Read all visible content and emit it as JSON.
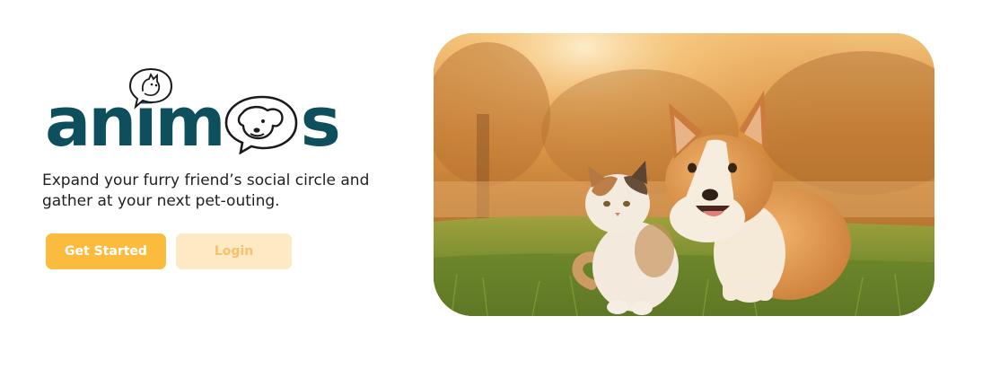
{
  "brand": {
    "logo_text": "animos"
  },
  "hero": {
    "tagline": "Expand your furry friend’s social circle and gather at your next pet-outing."
  },
  "actions": {
    "get_started_label": "Get Started",
    "login_label": "Login"
  },
  "colors": {
    "brand_teal": "#0d4f5c",
    "primary_button": "#fbbb3f",
    "secondary_button": "#fde9c3",
    "secondary_button_text": "#f6c16a"
  },
  "image": {
    "description_icon": "cat-and-corgi-photo"
  }
}
